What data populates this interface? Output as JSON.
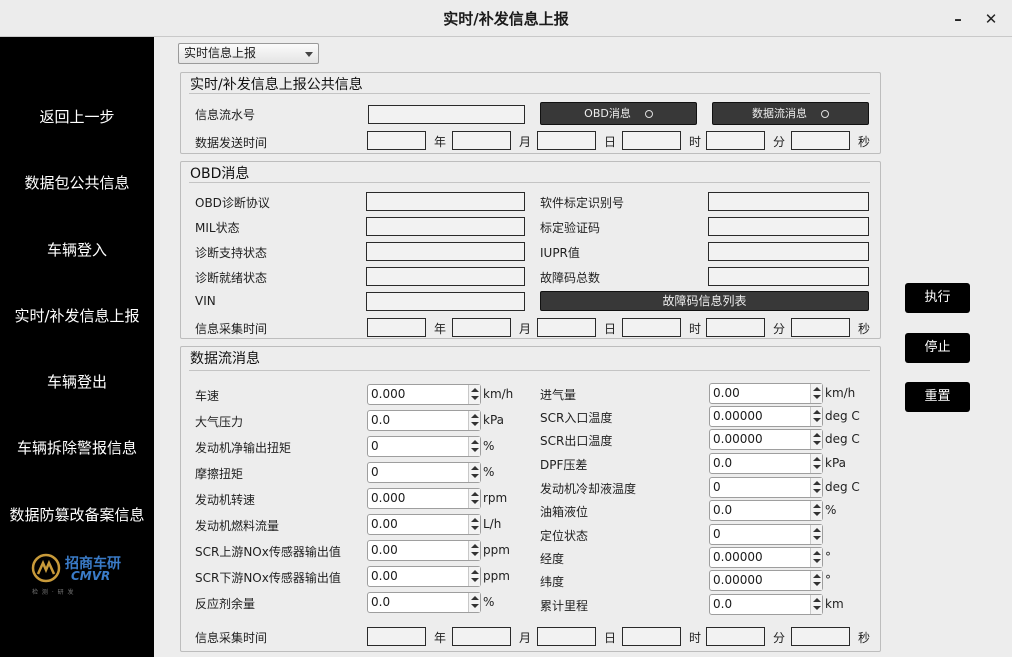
{
  "window": {
    "title": "实时/补发信息上报",
    "minimize": "–",
    "close": "✕"
  },
  "sidebar": {
    "items": [
      "返回上一步",
      "数据包公共信息",
      "车辆登入",
      "实时/补发信息上报",
      "车辆登出",
      "车辆拆除警报信息",
      "数据防篡改备案信息"
    ]
  },
  "logo": {
    "cn": "招商车研",
    "en": "CMVR",
    "tagline": "检 测 · 研 发"
  },
  "mode_select": {
    "value": "实时信息上报"
  },
  "date_units": [
    "年",
    "月",
    "日",
    "时",
    "分",
    "秒"
  ],
  "public_group": {
    "title": "实时/补发信息上报公共信息",
    "serial_label": "信息流水号",
    "send_time_label": "数据发送时间",
    "obd_button": "OBD消息",
    "stream_button": "数据流消息"
  },
  "obd_group": {
    "title": "OBD消息",
    "left_fields": [
      "OBD诊断协议",
      "MIL状态",
      "诊断支持状态",
      "诊断就绪状态",
      "VIN"
    ],
    "right_fields": [
      "软件标定识别号",
      "标定验证码",
      "IUPR值",
      "故障码总数"
    ],
    "fault_list_button": "故障码信息列表",
    "collect_time_label": "信息采集时间"
  },
  "stream_group": {
    "title": "数据流消息",
    "left_fields": [
      {
        "label": "车速",
        "value": "0.000",
        "unit": "km/h"
      },
      {
        "label": "大气压力",
        "value": "0.0",
        "unit": "kPa"
      },
      {
        "label": "发动机净输出扭矩",
        "value": "0",
        "unit": "%"
      },
      {
        "label": "摩擦扭矩",
        "value": "0",
        "unit": "%"
      },
      {
        "label": "发动机转速",
        "value": "0.000",
        "unit": "rpm"
      },
      {
        "label": "发动机燃料流量",
        "value": "0.00",
        "unit": "L/h"
      },
      {
        "label": "SCR上游NOx传感器输出值",
        "value": "0.00",
        "unit": "ppm"
      },
      {
        "label": "SCR下游NOx传感器输出值",
        "value": "0.00",
        "unit": "ppm"
      },
      {
        "label": "反应剂余量",
        "value": "0.0",
        "unit": "%"
      }
    ],
    "right_fields": [
      {
        "label": "进气量",
        "value": "0.00",
        "unit": "km/h"
      },
      {
        "label": "SCR入口温度",
        "value": "0.00000",
        "unit": "deg C"
      },
      {
        "label": "SCR出口温度",
        "value": "0.00000",
        "unit": "deg C"
      },
      {
        "label": "DPF压差",
        "value": "0.0",
        "unit": "kPa"
      },
      {
        "label": "发动机冷却液温度",
        "value": "0",
        "unit": "deg C"
      },
      {
        "label": "油箱液位",
        "value": "0.0",
        "unit": "%"
      },
      {
        "label": "定位状态",
        "value": "0",
        "unit": ""
      },
      {
        "label": "经度",
        "value": "0.00000",
        "unit": "°"
      },
      {
        "label": "纬度",
        "value": "0.00000",
        "unit": "°"
      },
      {
        "label": "累计里程",
        "value": "0.0",
        "unit": "km"
      }
    ],
    "collect_time_label": "信息采集时间"
  },
  "actions": {
    "execute": "执行",
    "stop": "停止",
    "reset": "重置"
  }
}
